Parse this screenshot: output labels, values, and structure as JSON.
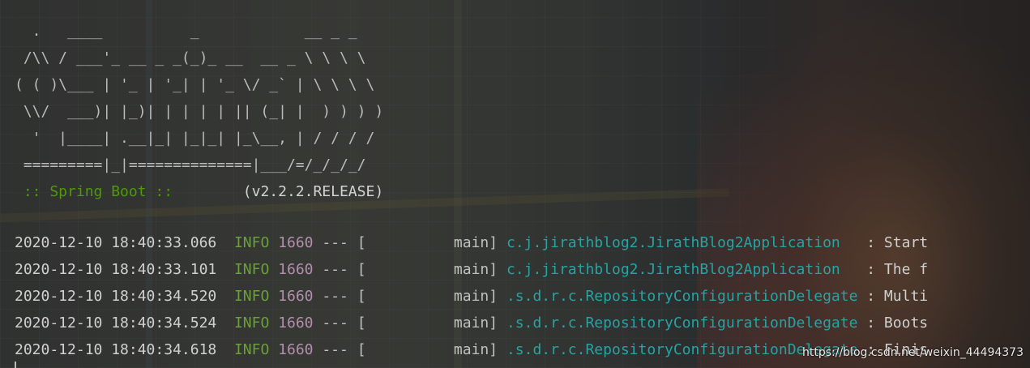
{
  "banner": {
    "ascii": [
      "  .   ____          _            __ _ _",
      " /\\\\ / ___'_ __ _ _(_)_ __  __ _ \\ \\ \\ \\",
      "( ( )\\___ | '_ | '_| | '_ \\/ _` | \\ \\ \\ \\",
      " \\\\/  ___)| |_)| | | | | || (_| |  ) ) ) )",
      "  '  |____| .__|_| |_|_| |_\\__, | / / / /",
      " =========|_|==============|___/=/_/_/_/"
    ],
    "spring_label": " :: Spring Boot :: ",
    "version": "       (v2.2.2.RELEASE)"
  },
  "log": [
    {
      "timestamp": "2020-12-10 18:40:33.066",
      "level": "INFO",
      "pid": "1660",
      "separator": "--- [",
      "thread": "          main]",
      "logger": "c.j.jirathblog2.JirathBlog2Application  ",
      "message": " : Start"
    },
    {
      "timestamp": "2020-12-10 18:40:33.101",
      "level": "INFO",
      "pid": "1660",
      "separator": "--- [",
      "thread": "          main]",
      "logger": "c.j.jirathblog2.JirathBlog2Application  ",
      "message": " : The f"
    },
    {
      "timestamp": "2020-12-10 18:40:34.520",
      "level": "INFO",
      "pid": "1660",
      "separator": "--- [",
      "thread": "          main]",
      "logger": ".s.d.r.c.RepositoryConfigurationDelegate",
      "message": " : Multi"
    },
    {
      "timestamp": "2020-12-10 18:40:34.524",
      "level": "INFO",
      "pid": "1660",
      "separator": "--- [",
      "thread": "          main]",
      "logger": ".s.d.r.c.RepositoryConfigurationDelegate",
      "message": " : Boots"
    },
    {
      "timestamp": "2020-12-10 18:40:34.618",
      "level": "INFO",
      "pid": "1660",
      "separator": "--- [",
      "thread": "          main]",
      "logger": ".s.d.r.c.RepositoryConfigurationDelegate",
      "message": " : Finis"
    }
  ],
  "watermark": "https://blog.csdn.net/weixin_44494373",
  "colors": {
    "spring_green": "#4e9a06",
    "info_green": "#6a9f3b",
    "pid_purple": "#b48ead",
    "logger_teal": "#27a3a3"
  }
}
